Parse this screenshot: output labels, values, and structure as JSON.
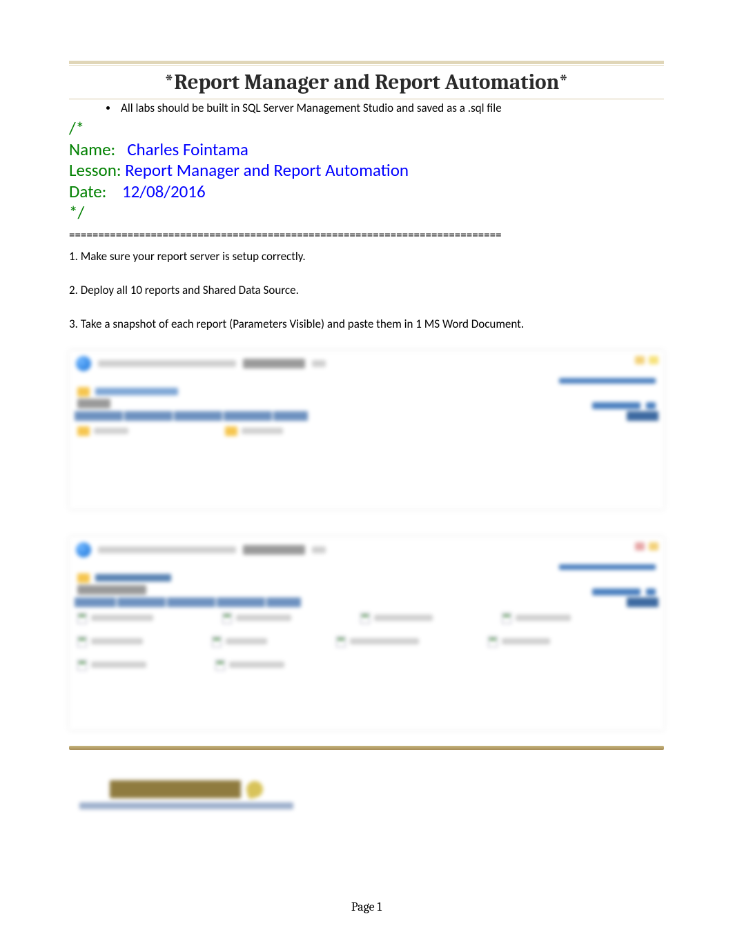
{
  "title": "*Report Manager and Report Automation*",
  "bullet": "All labs should be built in SQL Server Management Studio and saved as a .sql file",
  "sql": {
    "open": "/*",
    "name_label": "Name:",
    "name_value": "Charles Fointama",
    "lesson_label": "Lesson:",
    "lesson_value": "Report Manager and Report Automation",
    "date_label": "Date:",
    "date_value": "12/08/2016",
    "close": "*/"
  },
  "divider": "==========================================================================",
  "steps": {
    "s1": "1.  Make sure your report server is setup correctly.",
    "s2": "2.  Deploy all 10 reports and Shared Data Source.",
    "s3": "3.  Take a snapshot of each report (Parameters Visible) and paste them in 1 MS Word Document."
  },
  "page_footer": "Page 1"
}
